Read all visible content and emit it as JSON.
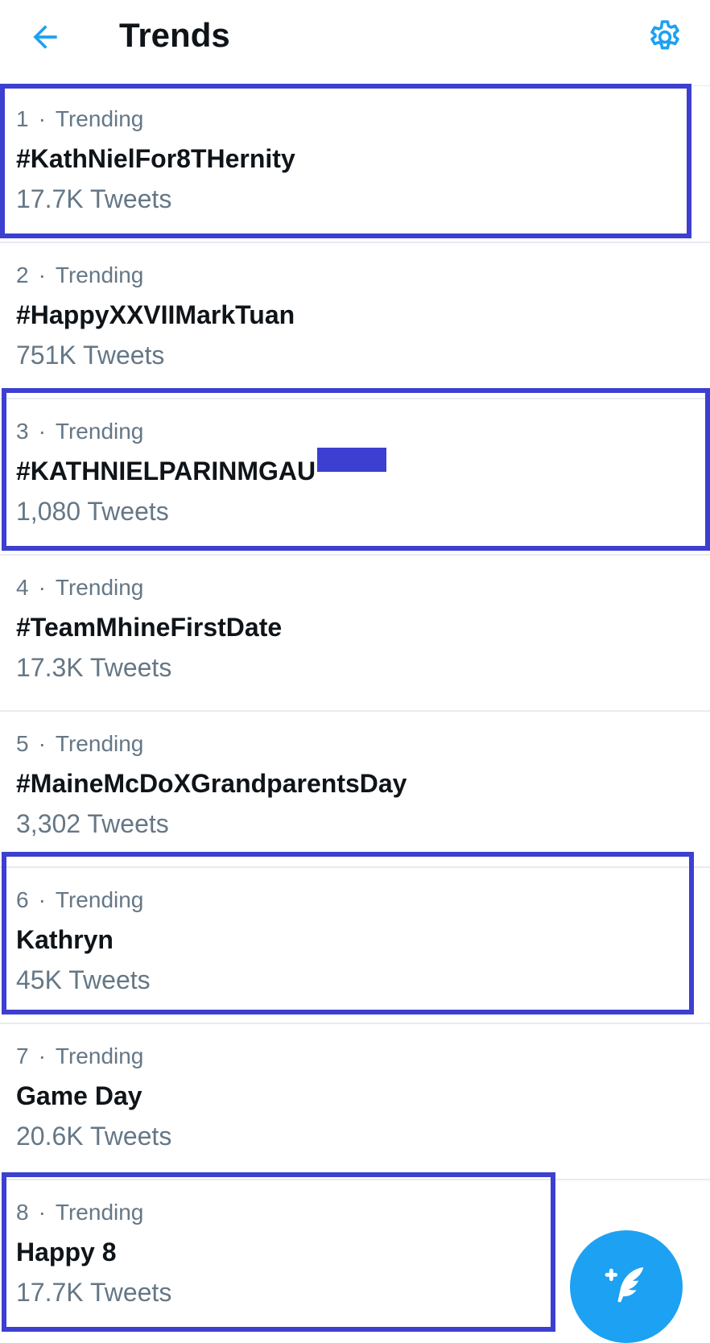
{
  "header": {
    "title": "Trends",
    "back_icon": "arrow-left-icon",
    "settings_icon": "gear-icon",
    "accent_color": "#1da1f2"
  },
  "trends": [
    {
      "rank": "1",
      "label": "Trending",
      "name": "#KathNielFor8THernity",
      "count": "17.7K Tweets",
      "highlighted": true
    },
    {
      "rank": "2",
      "label": "Trending",
      "name": "#HappyXXVIIMarkTuan",
      "count": "751K Tweets",
      "highlighted": false
    },
    {
      "rank": "3",
      "label": "Trending",
      "name": "#KATHNIELPARINMGAU",
      "count": "1,080 Tweets",
      "highlighted": true,
      "partially_redacted": true
    },
    {
      "rank": "4",
      "label": "Trending",
      "name": "#TeamMhineFirstDate",
      "count": "17.3K Tweets",
      "highlighted": false
    },
    {
      "rank": "5",
      "label": "Trending",
      "name": "#MaineMcDoXGrandparentsDay",
      "count": "3,302 Tweets",
      "highlighted": false
    },
    {
      "rank": "6",
      "label": "Trending",
      "name": "Kathryn",
      "count": "45K Tweets",
      "highlighted": true
    },
    {
      "rank": "7",
      "label": "Trending",
      "name": "Game Day",
      "count": "20.6K Tweets",
      "highlighted": false
    },
    {
      "rank": "8",
      "label": "Trending",
      "name": "Happy 8",
      "count": "17.7K Tweets",
      "highlighted": true
    }
  ],
  "separator": "·",
  "fab": {
    "icon": "compose-tweet-icon",
    "color": "#1da1f2"
  },
  "highlight_color": "#3c3fd0"
}
